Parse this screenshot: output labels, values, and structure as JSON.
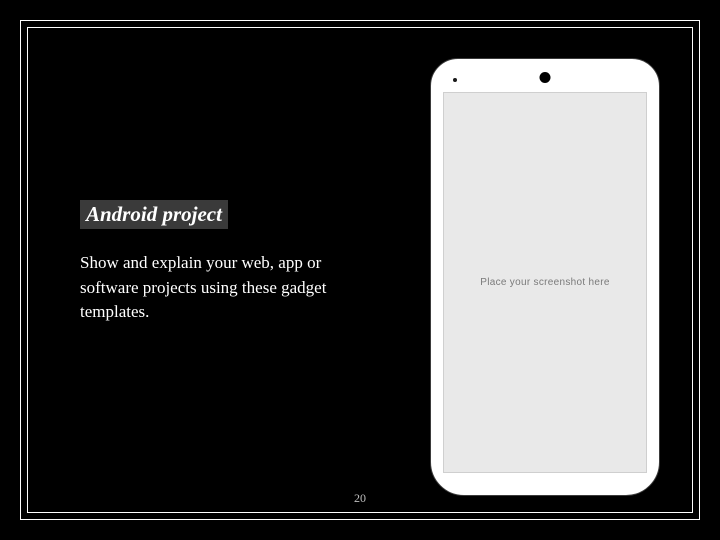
{
  "slide": {
    "title": "Android project",
    "body": "Show and explain your web, app or software projects using these gadget templates.",
    "pageNumber": "20"
  },
  "mockup": {
    "placeholder": "Place your screenshot here"
  }
}
